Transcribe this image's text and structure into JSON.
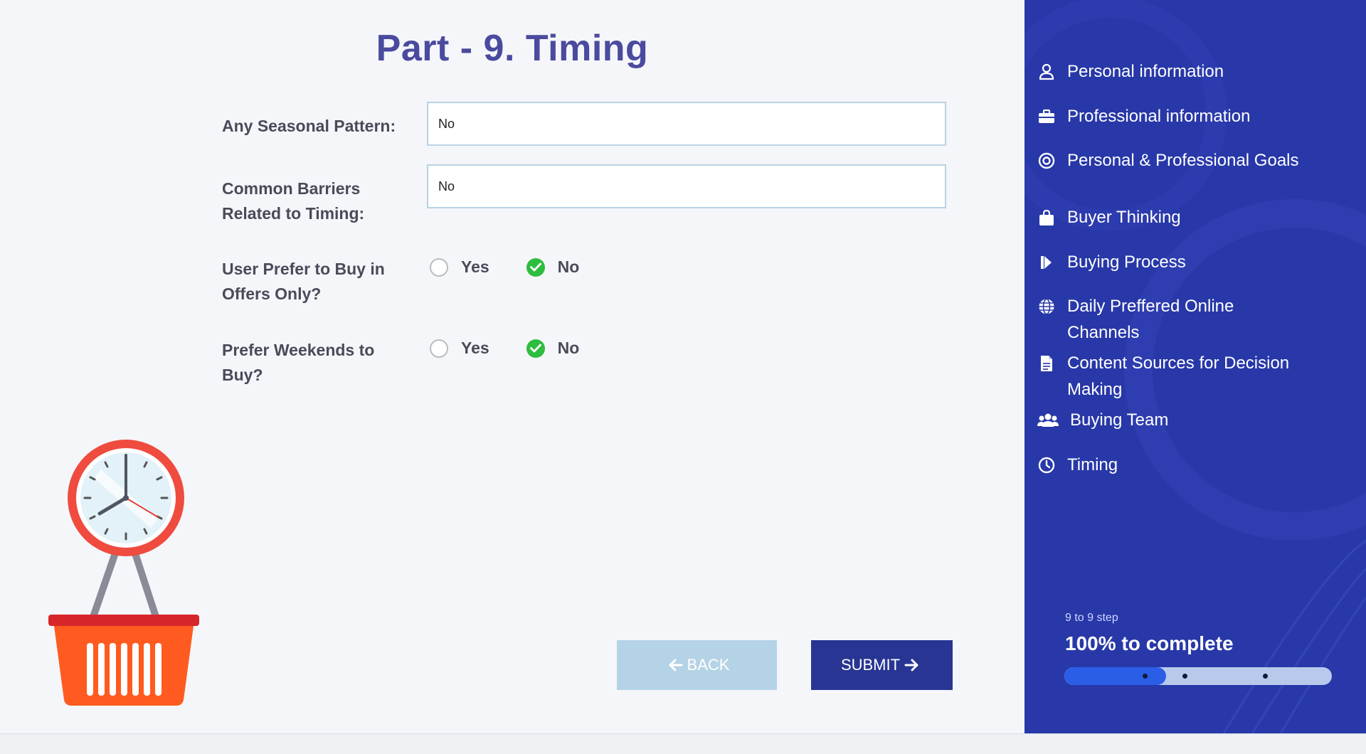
{
  "header": {
    "title": "Part - 9. Timing"
  },
  "form": {
    "seasonal": {
      "label": "Any Seasonal Pattern:",
      "value": "No"
    },
    "barriers": {
      "label": "Common Barriers Related to Timing:",
      "value": "No"
    },
    "offers": {
      "label": "User Prefer to Buy in Offers Only?",
      "options": [
        "Yes",
        "No"
      ],
      "selected": "No"
    },
    "weekends": {
      "label": "Prefer Weekends to Buy?",
      "options": [
        "Yes",
        "No"
      ],
      "selected": "No"
    }
  },
  "buttons": {
    "back_label": "BACK",
    "submit_label": "SUBMIT"
  },
  "sidebar": {
    "items": [
      {
        "label": "Personal information",
        "icon": "user-icon"
      },
      {
        "label": "Professional information",
        "icon": "briefcase-icon"
      },
      {
        "label": "Personal & Professional Goals",
        "icon": "target-icon"
      },
      {
        "label": "Buyer Thinking",
        "icon": "shopping-bag-icon"
      },
      {
        "label": "Buying Process",
        "icon": "step-forward-icon"
      },
      {
        "label": "Daily Preffered Online Channels",
        "icon": "globe-icon"
      },
      {
        "label": "Content Sources for Decision Making",
        "icon": "document-icon"
      },
      {
        "label": "Buying Team",
        "icon": "users-icon"
      },
      {
        "label": "Timing",
        "icon": "clock-icon"
      }
    ]
  },
  "progress": {
    "step_text": "9 to 9 step",
    "complete_text": "100% to complete",
    "fill_fraction": 0.38
  },
  "colors": {
    "sidebar": "#2838a8",
    "submit": "#283593",
    "back": "#b5d3e6",
    "check": "#2ebd3f",
    "title": "#4a4a9e"
  }
}
